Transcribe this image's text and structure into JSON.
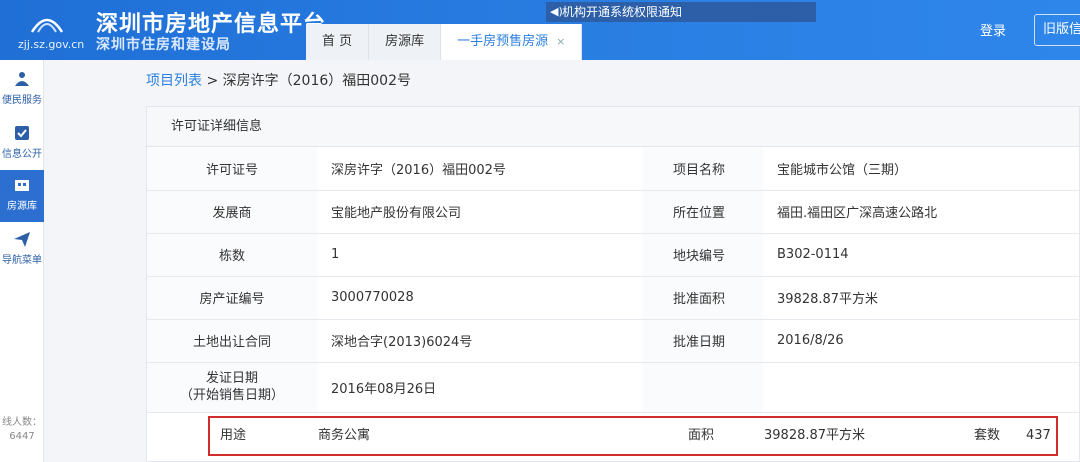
{
  "header": {
    "title": "深圳市房地产信息平台",
    "subtitle": "深圳市住房和建设局",
    "domain": "zjj.sz.gov.cn",
    "notice": "机构开通系统权限通知",
    "login": "登录",
    "old_version": "旧版信"
  },
  "tabs": [
    {
      "label": "首 页"
    },
    {
      "label": "房源库"
    },
    {
      "label": "一手房预售房源",
      "close": "×"
    }
  ],
  "sidebar": {
    "items": [
      {
        "label": "便民服务",
        "icon": "service-icon"
      },
      {
        "label": "信息公开",
        "icon": "check-icon"
      },
      {
        "label": "房源库",
        "icon": "building-icon"
      },
      {
        "label": "导航菜单",
        "icon": "send-icon"
      }
    ],
    "online_label": "线人数：",
    "online_count": "6447"
  },
  "breadcrumb": {
    "link": "项目列表",
    "separator": ">",
    "current": "深房许字（2016）福田002号"
  },
  "panel": {
    "title": "许可证详细信息",
    "rows": [
      {
        "l1": "许可证号",
        "v1": "深房许字（2016）福田002号",
        "l2": "项目名称",
        "v2": "宝能城市公馆（三期）"
      },
      {
        "l1": "发展商",
        "v1": "宝能地产股份有限公司",
        "l2": "所在位置",
        "v2": "福田.福田区广深高速公路北"
      },
      {
        "l1": "栋数",
        "v1": "1",
        "l2": "地块编号",
        "v2": "B302-0114"
      },
      {
        "l1": "房产证编号",
        "v1": "3000770028",
        "l2": "批准面积",
        "v2": "39828.87平方米"
      },
      {
        "l1": "土地出让合同",
        "v1": "深地合字(2013)6024号",
        "l2": "批准日期",
        "v2": "2016/8/26"
      }
    ],
    "issue_row": {
      "l1a": "发证日期",
      "l1b": "（开始销售日期）",
      "v1": "2016年08月26日"
    },
    "usage_row": {
      "usage_label": "用途",
      "usage_value": "商务公寓",
      "area_label": "面积",
      "area_value": "39828.87平方米",
      "units_label": "套数",
      "units_value": "437"
    }
  },
  "colors": {
    "accent": "#2b7fe0",
    "header": "#1f6fd6",
    "highlight": "#d12c2c"
  }
}
